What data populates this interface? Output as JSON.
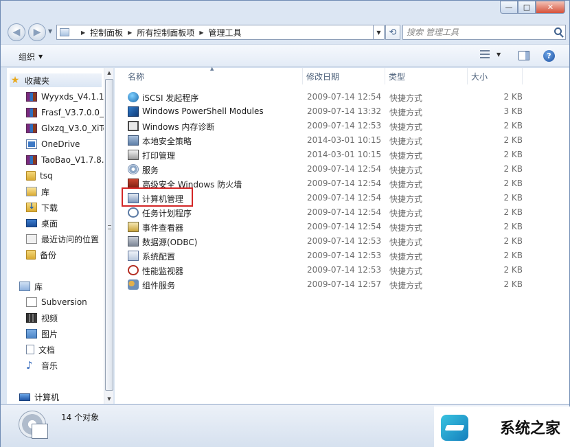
{
  "window": {
    "caption_buttons": {
      "minimize": "—",
      "maximize": "□",
      "close": "✕"
    }
  },
  "address_bar": {
    "breadcrumbs": [
      "控制面板",
      "所有控制面板项",
      "管理工具"
    ],
    "search_placeholder": "搜索 管理工具"
  },
  "toolbar": {
    "organize_label": "组织"
  },
  "sidebar": {
    "favorites": [
      {
        "label": "收藏夹",
        "icon": "star-icon"
      },
      {
        "label": "Wyyxds_V4.1.1.1",
        "icon": "rar-icon"
      },
      {
        "label": "Frasf_V3.7.0.0_X",
        "icon": "rar-icon"
      },
      {
        "label": "Glxzq_V3.0_XiTo",
        "icon": "rar-icon"
      },
      {
        "label": "OneDrive",
        "icon": "onedrive-icon"
      },
      {
        "label": "TaoBao_V1.7.8.",
        "icon": "rar-icon"
      },
      {
        "label": "tsq",
        "icon": "folder-icon"
      },
      {
        "label": "库",
        "icon": "library-icon"
      },
      {
        "label": "下载",
        "icon": "downloads-icon"
      },
      {
        "label": "桌面",
        "icon": "desktop-icon"
      },
      {
        "label": "最近访问的位置",
        "icon": "recent-places-icon"
      },
      {
        "label": "备份",
        "icon": "folder-icon"
      }
    ],
    "libraries": [
      {
        "label": "库",
        "icon": "libraries-icon"
      },
      {
        "label": "Subversion",
        "icon": "subversion-icon"
      },
      {
        "label": "视频",
        "icon": "video-icon"
      },
      {
        "label": "图片",
        "icon": "pictures-icon"
      },
      {
        "label": "文档",
        "icon": "documents-icon"
      },
      {
        "label": "音乐",
        "icon": "music-icon"
      }
    ],
    "computer": {
      "label": "计算机",
      "icon": "computer-icon"
    }
  },
  "columns": {
    "name": "名称",
    "date": "修改日期",
    "type": "类型",
    "size": "大小"
  },
  "files": [
    {
      "name": "iSCSI 发起程序",
      "date": "2009-07-14 12:54",
      "type": "快捷方式",
      "size": "2 KB",
      "icon": "iscsi-icon"
    },
    {
      "name": "Windows PowerShell Modules",
      "date": "2009-07-14 13:32",
      "type": "快捷方式",
      "size": "3 KB",
      "icon": "powershell-icon"
    },
    {
      "name": "Windows 内存诊断",
      "date": "2009-07-14 12:53",
      "type": "快捷方式",
      "size": "2 KB",
      "icon": "memory-diagnostic-icon"
    },
    {
      "name": "本地安全策略",
      "date": "2014-03-01 10:15",
      "type": "快捷方式",
      "size": "2 KB",
      "icon": "security-policy-icon"
    },
    {
      "name": "打印管理",
      "date": "2014-03-01 10:15",
      "type": "快捷方式",
      "size": "2 KB",
      "icon": "print-management-icon"
    },
    {
      "name": "服务",
      "date": "2009-07-14 12:54",
      "type": "快捷方式",
      "size": "2 KB",
      "icon": "services-icon"
    },
    {
      "name": "高级安全 Windows 防火墙",
      "date": "2009-07-14 12:54",
      "type": "快捷方式",
      "size": "2 KB",
      "icon": "firewall-icon"
    },
    {
      "name": "计算机管理",
      "date": "2009-07-14 12:54",
      "type": "快捷方式",
      "size": "2 KB",
      "icon": "computer-management-icon"
    },
    {
      "name": "任务计划程序",
      "date": "2009-07-14 12:54",
      "type": "快捷方式",
      "size": "2 KB",
      "icon": "task-scheduler-icon"
    },
    {
      "name": "事件查看器",
      "date": "2009-07-14 12:54",
      "type": "快捷方式",
      "size": "2 KB",
      "icon": "event-viewer-icon"
    },
    {
      "name": "数据源(ODBC)",
      "date": "2009-07-14 12:53",
      "type": "快捷方式",
      "size": "2 KB",
      "icon": "odbc-icon"
    },
    {
      "name": "系统配置",
      "date": "2009-07-14 12:53",
      "type": "快捷方式",
      "size": "2 KB",
      "icon": "system-config-icon"
    },
    {
      "name": "性能监视器",
      "date": "2009-07-14 12:53",
      "type": "快捷方式",
      "size": "2 KB",
      "icon": "performance-monitor-icon"
    },
    {
      "name": "组件服务",
      "date": "2009-07-14 12:57",
      "type": "快捷方式",
      "size": "2 KB",
      "icon": "component-services-icon"
    }
  ],
  "status": {
    "item_count": "14 个对象"
  },
  "watermark": {
    "text": "系统之家"
  },
  "colors": {
    "highlight_box": "#d32626",
    "window_frame": "#dce6f3"
  }
}
